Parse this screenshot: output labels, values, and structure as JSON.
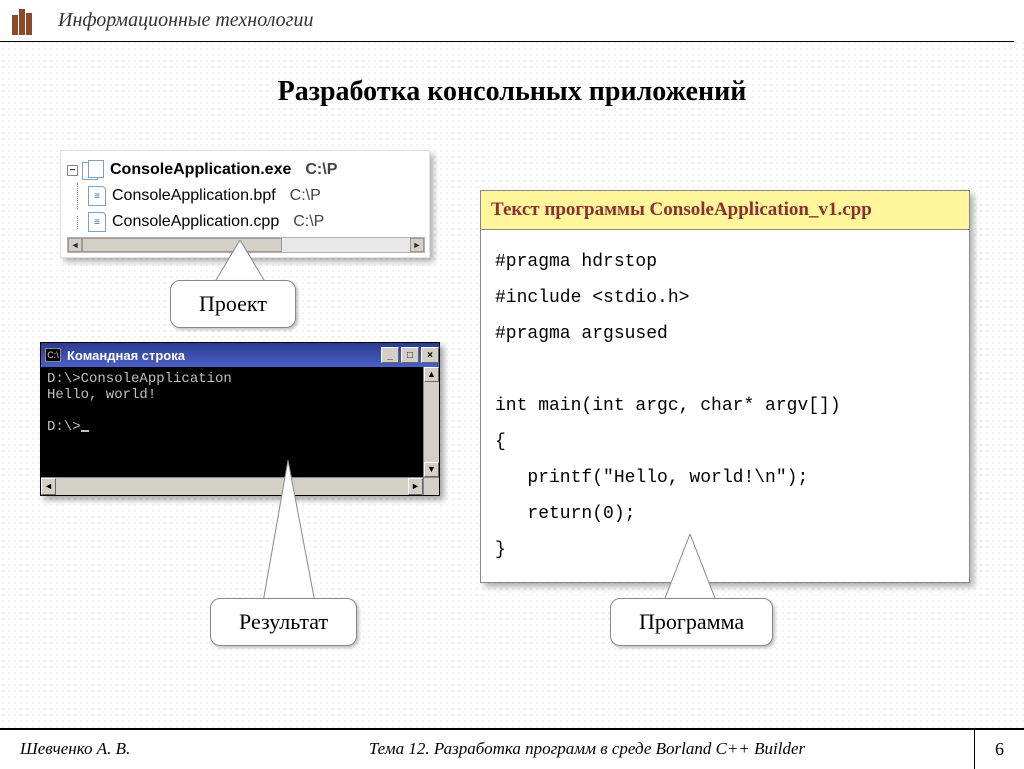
{
  "header": {
    "title": "Информационные технологии"
  },
  "page_title": "Разработка консольных приложений",
  "tree": {
    "items": [
      {
        "name": "ConsoleApplication.exe",
        "path": "C:\\P",
        "bold": true,
        "kind": "exe"
      },
      {
        "name": "ConsoleApplication.bpf",
        "path": "C:\\P",
        "bold": false,
        "kind": "bpf"
      },
      {
        "name": "ConsoleApplication.cpp",
        "path": "C:\\P",
        "bold": false,
        "kind": "cpp"
      }
    ],
    "toggle_glyph": "−"
  },
  "callouts": {
    "project": "Проект",
    "result": "Результат",
    "program": "Программа"
  },
  "console": {
    "title": "Командная строка",
    "sys_icon": "C:\\",
    "lines": "D:\\>ConsoleApplication\nHello, world!\n\nD:\\>"
  },
  "code": {
    "title": "Текст программы ConsoleApplication_v1.cpp",
    "body": "#pragma hdrstop\n#include <stdio.h>\n#pragma argsused\n\nint main(int argc, char* argv[])\n{\n   printf(\"Hello, world!\\n\");\n   return(0);\n}"
  },
  "footer": {
    "author": "Шевченко А. В.",
    "topic": "Тема 12. Разработка программ в среде Borland C++ Builder",
    "page": "6"
  }
}
